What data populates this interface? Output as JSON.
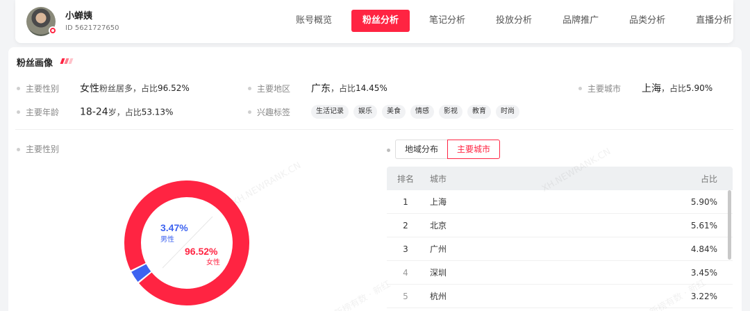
{
  "user": {
    "name": "小蝉姨",
    "id": "ID 5621727650"
  },
  "nav": [
    {
      "label": "账号概览",
      "active": false
    },
    {
      "label": "粉丝分析",
      "active": true
    },
    {
      "label": "笔记分析",
      "active": false
    },
    {
      "label": "投放分析",
      "active": false
    },
    {
      "label": "品牌推广",
      "active": false
    },
    {
      "label": "品类分析",
      "active": false
    },
    {
      "label": "直播分析",
      "active": false
    }
  ],
  "section_title": "粉丝画像",
  "profile": {
    "gender": {
      "label": "主要性别",
      "main": "女性",
      "sub": "粉丝居多，占比",
      "pct": "96.52%"
    },
    "region": {
      "label": "主要地区",
      "main": "广东",
      "sub": "，占比",
      "pct": "14.45%"
    },
    "city": {
      "label": "主要城市",
      "main": "上海",
      "sub": "，占比",
      "pct": "5.90%"
    },
    "age": {
      "label": "主要年龄",
      "main": "18-24",
      "sub": "岁，占比",
      "pct": "53.13%"
    },
    "interest": {
      "label": "兴趣标签",
      "tags": [
        "生活记录",
        "娱乐",
        "美食",
        "情感",
        "影视",
        "教育",
        "时尚"
      ]
    }
  },
  "gender_chart_label": "主要性别",
  "chart_data": {
    "type": "pie",
    "series": [
      {
        "name": "男性",
        "value": 3.47,
        "label": "3.47%",
        "color": "#3d63f0"
      },
      {
        "name": "女性",
        "value": 96.52,
        "label": "96.52%",
        "color": "#ff2442"
      }
    ]
  },
  "segment": [
    {
      "label": "地域分布",
      "active": false
    },
    {
      "label": "主要城市",
      "active": true
    }
  ],
  "table": {
    "headers": {
      "rank": "排名",
      "city": "城市",
      "pct": "占比"
    },
    "rows": [
      {
        "rank": "1",
        "city": "上海",
        "pct": "5.90%"
      },
      {
        "rank": "2",
        "city": "北京",
        "pct": "5.61%"
      },
      {
        "rank": "3",
        "city": "广州",
        "pct": "4.84%"
      },
      {
        "rank": "4",
        "city": "深圳",
        "pct": "3.45%"
      },
      {
        "rank": "5",
        "city": "杭州",
        "pct": "3.22%"
      }
    ]
  },
  "watermark": {
    "brand": "XH.NEWRANK.CN",
    "cn": "新榜有数 · 新红"
  },
  "colors": {
    "accent": "#ff2442",
    "male": "#3d63f0"
  }
}
